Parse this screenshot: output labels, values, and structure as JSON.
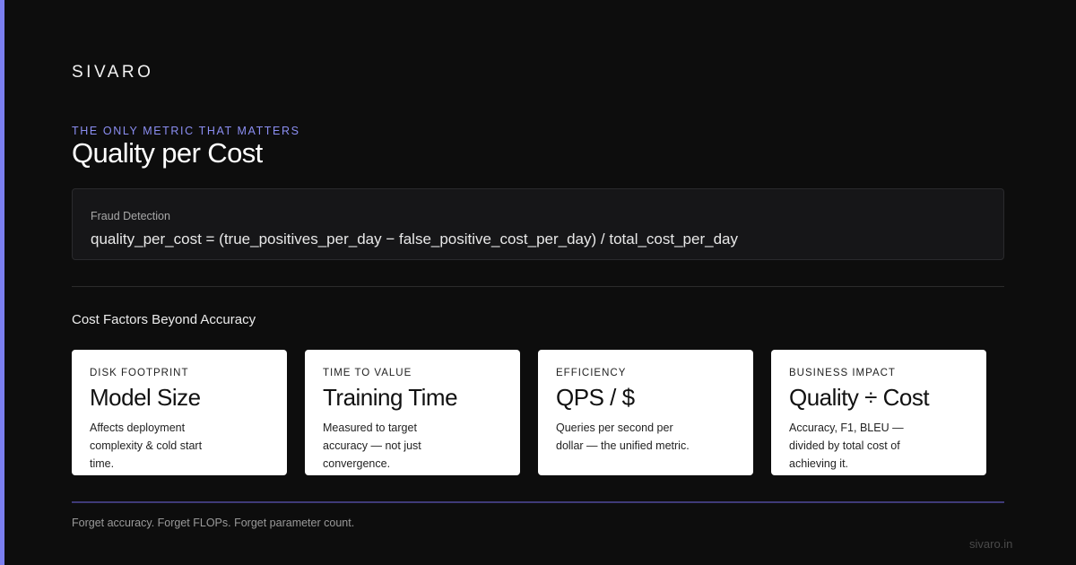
{
  "colors": {
    "background": "#0d0d0d",
    "accent": "#7b7ff0",
    "card": "#ffffff"
  },
  "brand": "SIVARO",
  "eyebrow": "THE ONLY METRIC THAT MATTERS",
  "title": "Quality per Cost",
  "formula": {
    "label": "Fraud Detection",
    "text": "quality_per_cost = (true_positives_per_day − false_positive_cost_per_day) / total_cost_per_day"
  },
  "section_title": "Cost Factors Beyond Accuracy",
  "cards": [
    {
      "kicker": "DISK FOOTPRINT",
      "title": "Model Size",
      "desc": "Affects deployment complexity & cold start time."
    },
    {
      "kicker": "TIME TO VALUE",
      "title": "Training Time",
      "desc": "Measured to target accuracy — not just convergence."
    },
    {
      "kicker": "EFFICIENCY",
      "title": "QPS / $",
      "desc": "Queries per second per dollar — the unified metric."
    },
    {
      "kicker": "BUSINESS IMPACT",
      "title": "Quality ÷ Cost",
      "desc": "Accuracy, F1, BLEU — divided by total cost of achieving it."
    }
  ],
  "footer_note": "Forget accuracy. Forget FLOPs. Forget parameter count.",
  "site": "sivaro.in"
}
